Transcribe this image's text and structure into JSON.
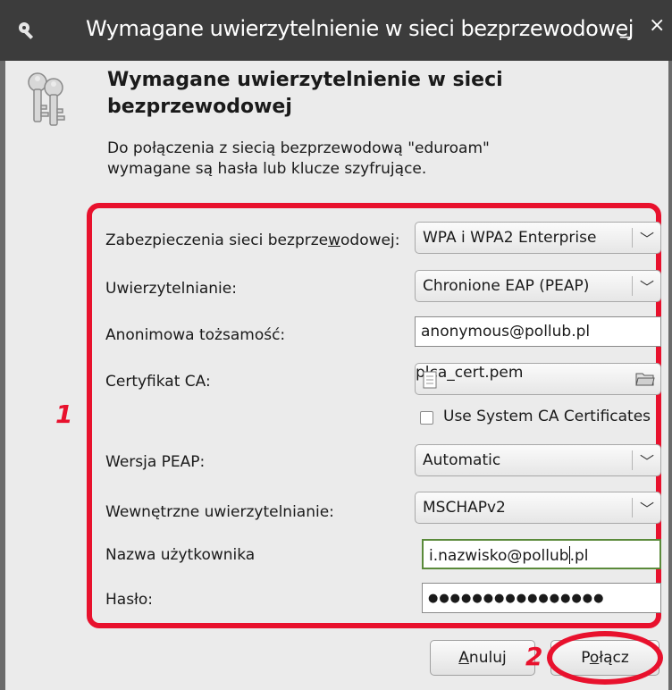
{
  "window": {
    "title": "Wymagane uwierzytelnienie w sieci bezprzewodowej",
    "minimize_glyph": "_",
    "close_glyph": "×"
  },
  "header": {
    "heading_line1": "Wymagane uwierzytelnienie w sieci",
    "heading_line2": "bezprzewodowej",
    "desc_line1": "Do połączenia z siecią bezprzewodową \"eduroam\"",
    "desc_line2": "wymagane są hasła lub klucze szyfrujące.",
    "icon": "keys-icon"
  },
  "form": {
    "security_label_pre": "Zabezpieczenia sieci bezprze",
    "security_label_mnemonic": "w",
    "security_label_post": "odowej:",
    "security_value": "WPA i WPA2 Enterprise",
    "auth_label": "Uwierzytelnianie:",
    "auth_value": "Chronione EAP (PEAP)",
    "anon_label": "Anonimowa tożsamość:",
    "anon_value": "anonymous@pollub.pl",
    "ca_label": "Certyfikat CA:",
    "ca_value": "plca_cert.pem",
    "system_ca_label": "Use System CA Certificates",
    "system_ca_checked": false,
    "peap_label": "Wersja PEAP:",
    "peap_value": "Automatic",
    "inner_label": "Wewnętrzne uwierzytelnianie:",
    "inner_value": "MSCHAPv2",
    "user_label": "Nazwa użytkownika",
    "user_value_before_cursor": "i.nazwisko@pollub",
    "user_value_after_cursor": ".pl",
    "pass_label": "Hasło:",
    "pass_value": "●●●●●●●●●●●●●●●●"
  },
  "annotations": {
    "marker1": "1",
    "marker2": "2",
    "color": "#e8112d"
  },
  "buttons": {
    "cancel_mnemonic": "A",
    "cancel_rest": "nuluj",
    "connect_pre": "P",
    "connect_mnemonic": "o",
    "connect_post": "łącz"
  }
}
